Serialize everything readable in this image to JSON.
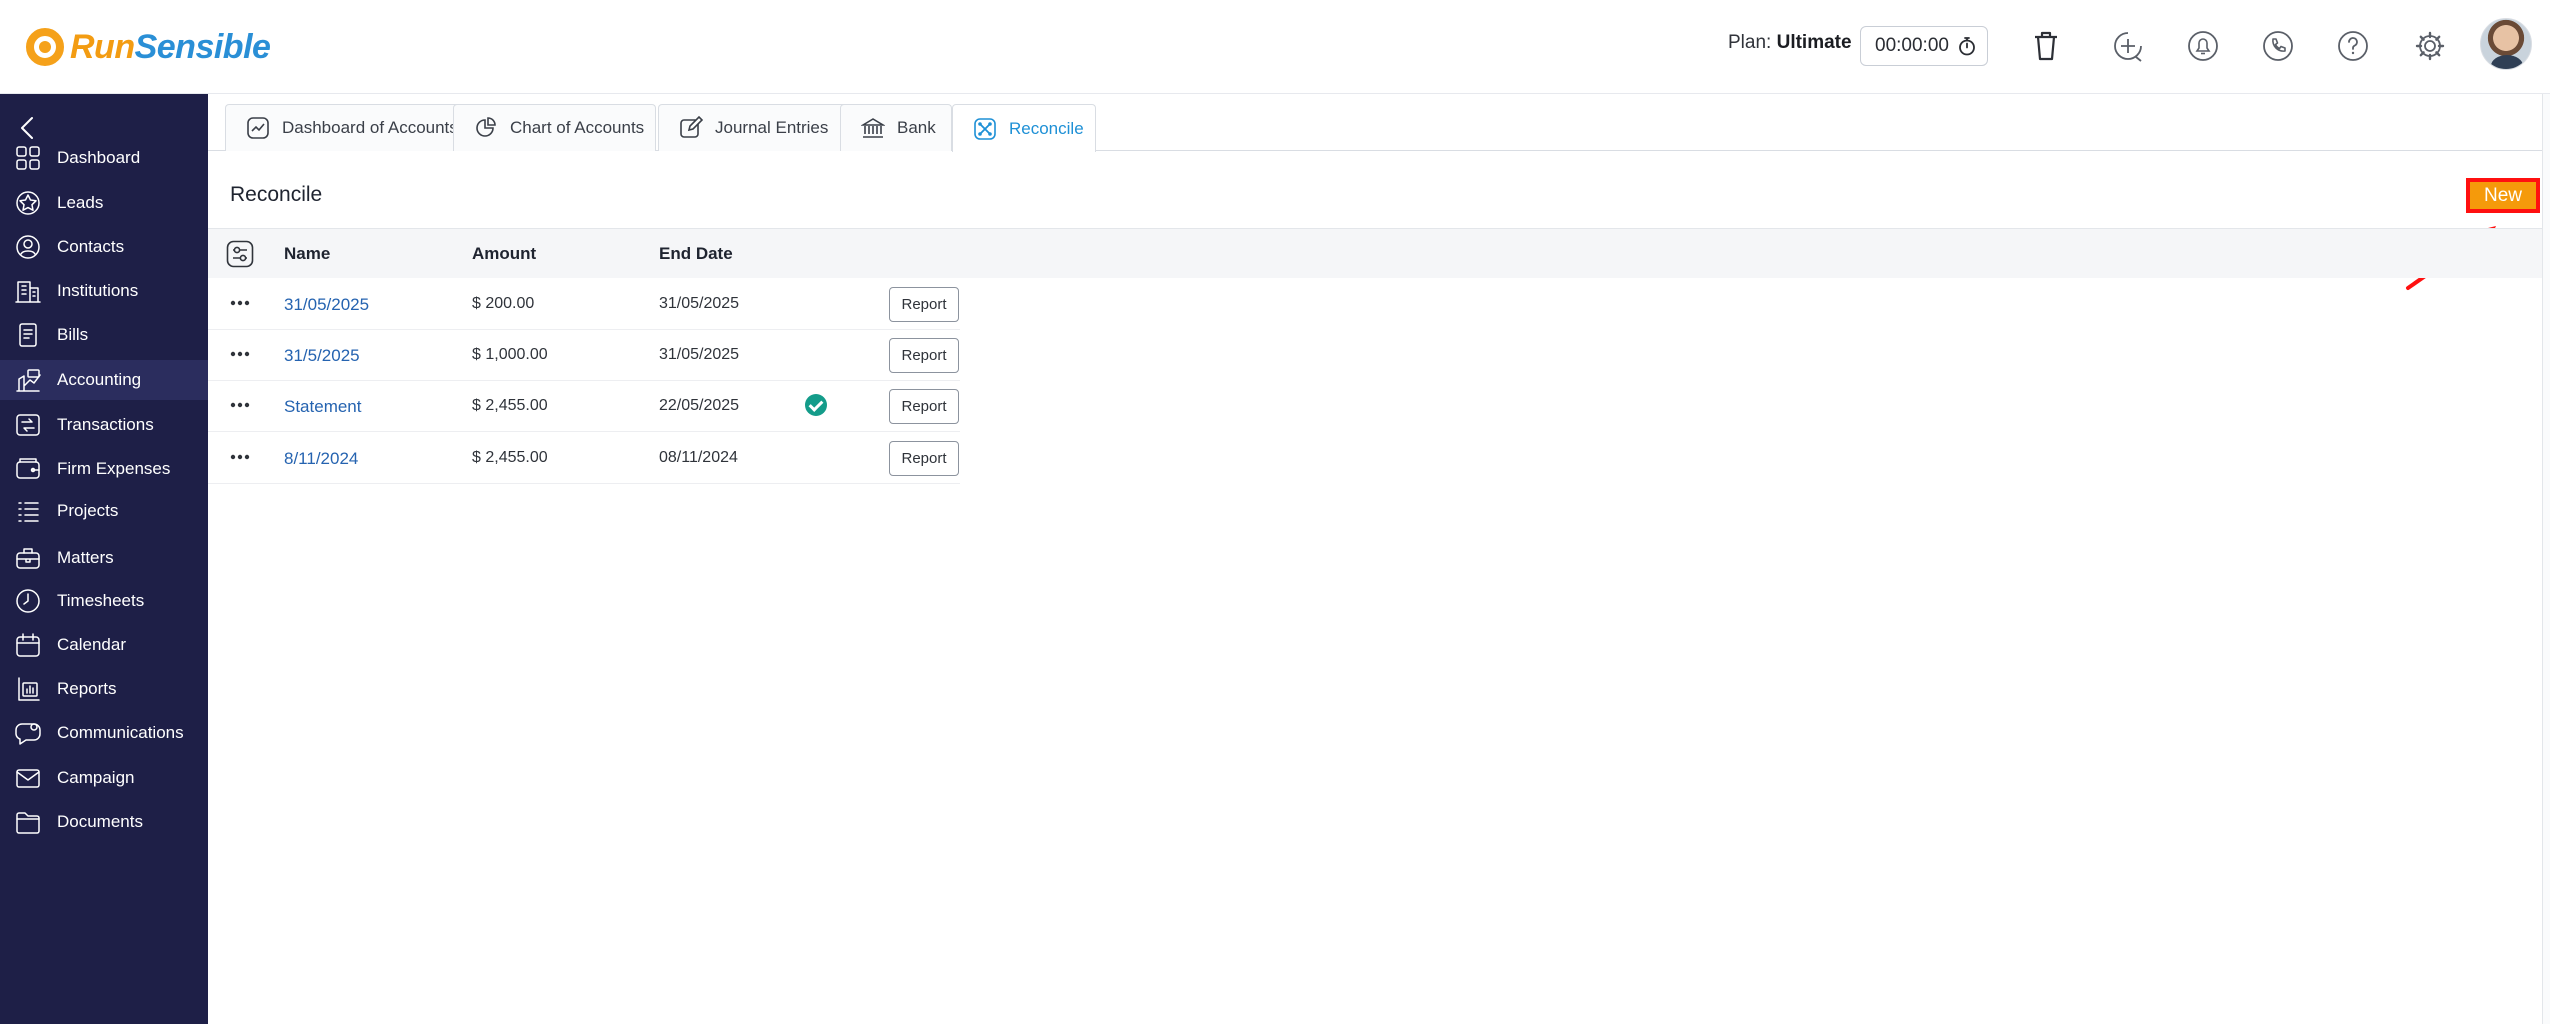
{
  "brand": {
    "run": "Run",
    "sensible": "Sensible"
  },
  "header": {
    "plan_label": "Plan:",
    "plan_value": "Ultimate",
    "timer": "00:00:00",
    "icons": [
      "trash-icon",
      "add-time-icon",
      "notifications-icon",
      "phone-icon",
      "help-icon",
      "settings-icon"
    ]
  },
  "sidebar": {
    "items": [
      {
        "label": "Dashboard",
        "icon": "dashboard-icon"
      },
      {
        "label": "Leads",
        "icon": "leads-icon"
      },
      {
        "label": "Contacts",
        "icon": "contacts-icon"
      },
      {
        "label": "Institutions",
        "icon": "institutions-icon"
      },
      {
        "label": "Bills",
        "icon": "bills-icon"
      },
      {
        "label": "Accounting",
        "icon": "accounting-icon",
        "active": true
      },
      {
        "label": "Transactions",
        "icon": "transactions-icon"
      },
      {
        "label": "Firm Expenses",
        "icon": "firm-expenses-icon"
      },
      {
        "label": "Projects",
        "icon": "projects-icon"
      },
      {
        "label": "Matters",
        "icon": "matters-icon"
      },
      {
        "label": "Timesheets",
        "icon": "timesheets-icon"
      },
      {
        "label": "Calendar",
        "icon": "calendar-icon"
      },
      {
        "label": "Reports",
        "icon": "reports-icon"
      },
      {
        "label": "Communications",
        "icon": "communications-icon"
      },
      {
        "label": "Campaign",
        "icon": "campaign-icon"
      },
      {
        "label": "Documents",
        "icon": "documents-icon"
      }
    ]
  },
  "tabs": [
    {
      "label": "Dashboard of Accounts",
      "icon": "chart-line-icon"
    },
    {
      "label": "Chart of Accounts",
      "icon": "pie-chart-icon"
    },
    {
      "label": "Journal Entries",
      "icon": "edit-icon"
    },
    {
      "label": "Bank",
      "icon": "bank-icon"
    },
    {
      "label": "Reconcile",
      "icon": "reconcile-icon",
      "active": true
    }
  ],
  "page": {
    "title": "Reconcile",
    "new_label": "New"
  },
  "table": {
    "columns": [
      "Name",
      "Amount",
      "End Date"
    ],
    "report_label": "Report",
    "rows": [
      {
        "name": "31/05/2025",
        "amount": "$ 200.00",
        "end_date": "31/05/2025",
        "reconciled": false
      },
      {
        "name": "31/5/2025",
        "amount": "$ 1,000.00",
        "end_date": "31/05/2025",
        "reconciled": false
      },
      {
        "name": "Statement",
        "amount": "$ 2,455.00",
        "end_date": "22/05/2025",
        "reconciled": true
      },
      {
        "name": "8/11/2024",
        "amount": "$ 2,455.00",
        "end_date": "08/11/2024",
        "reconciled": false
      }
    ]
  },
  "colors": {
    "sidebar": "#1e1f47",
    "accent": "#1e90d6",
    "new_button": "#f59a0b",
    "highlight": "#ff1010"
  }
}
